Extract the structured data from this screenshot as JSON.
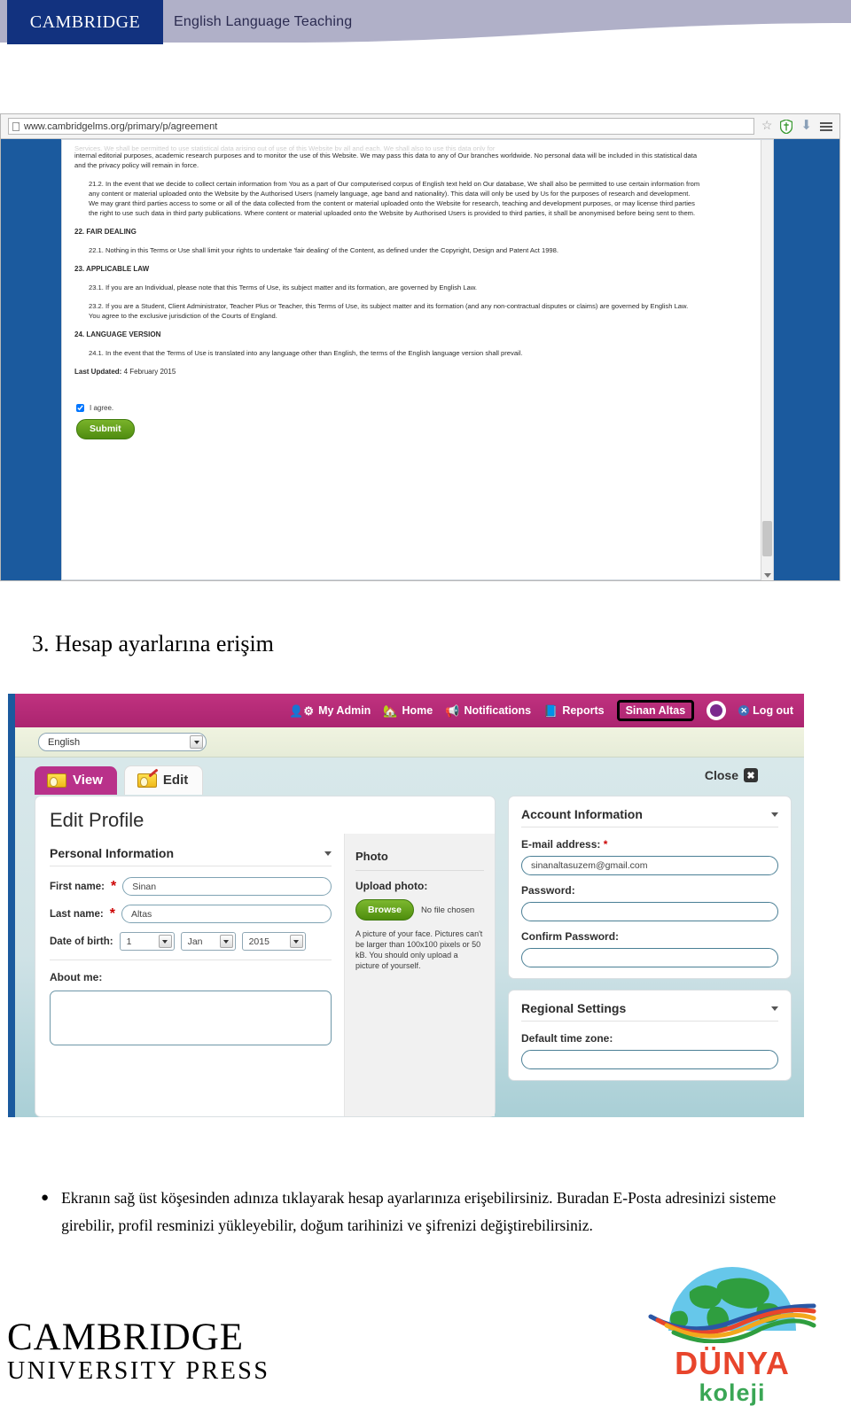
{
  "banner": {
    "brand": "CAMBRIDGE",
    "tagline": "English Language Teaching"
  },
  "browser": {
    "url": "www.cambridgelms.org/primary/p/agreement",
    "icons": {
      "page": "page-icon",
      "bookmark": "star-icon",
      "shield": "shield-icon",
      "download": "download-arrow-icon",
      "menu": "hamburger-menu-icon"
    }
  },
  "agreement": {
    "clipped_line": "Services. We shall be permitted to use statistical data arising out of use of this Website by all and each. We shall also to use this data only for",
    "para_1": "internal editorial purposes, academic research purposes and to monitor the use of this Website. We may pass this data to any of Our branches worldwide. No personal data will be included in this statistical data and the privacy policy will remain in force.",
    "para_21_2": "21.2. In the event that we decide to collect certain information from You as a part of Our computerised corpus of English text held on Our database, We shall also be permitted to use certain information from any content or material uploaded onto the Website by the Authorised Users (namely language, age band and nationality). This data will only be used by Us for the purposes of research and development. We may grant third parties access to some or all of the data collected from the content or material uploaded onto the Website for research, teaching and development purposes, or may license third parties the right to use such data in third party publications. Where content or material uploaded onto the Website by Authorised Users is provided to third parties, it shall be anonymised before being sent to them.",
    "head_22": "22. FAIR DEALING",
    "para_22_1": "22.1. Nothing in this Terms or Use shall limit your rights to undertake 'fair dealing' of the Content, as defined under the Copyright, Design and Patent Act 1998.",
    "head_23": "23. APPLICABLE LAW",
    "para_23_1": "23.1. If you are an Individual, please note that this Terms of Use, its subject matter and its formation, are governed by English Law.",
    "para_23_2": "23.2. If you are a Student, Client Administrator, Teacher Plus or Teacher, this Terms of Use, its subject matter and its formation (and any non-contractual disputes or claims) are governed by English Law. You agree to the exclusive jurisdiction of the Courts of England.",
    "head_24": "24. LANGUAGE VERSION",
    "para_24_1": "24.1. In the event that the Terms of Use is translated into any language other than English, the terms of the English language version shall prevail.",
    "last_updated_label": "Last Updated:",
    "last_updated_value": "4 February 2015",
    "agree_label": "I agree.",
    "submit_label": "Submit"
  },
  "section_heading": "3. Hesap ayarlarına erişim",
  "app": {
    "nav": [
      {
        "label": "My Admin",
        "icon": "admin-user-icon"
      },
      {
        "label": "Home",
        "icon": "home-icon"
      },
      {
        "label": "Notifications",
        "icon": "megaphone-icon"
      },
      {
        "label": "Reports",
        "icon": "reports-book-icon"
      }
    ],
    "username": "Sinan Altas",
    "logout_label": "Log out",
    "language_selected": "English",
    "tabs": [
      {
        "label": "View",
        "active": true,
        "icon": "view-card-icon"
      },
      {
        "label": "Edit",
        "active": false,
        "icon": "edit-pencil-icon"
      }
    ],
    "close_label": "Close",
    "edit_profile_title": "Edit Profile",
    "personal": {
      "section_title": "Personal Information",
      "first_name_label": "First name:",
      "first_name_value": "Sinan",
      "last_name_label": "Last name:",
      "last_name_value": "Altas",
      "dob_label": "Date of birth:",
      "dob_day": "1",
      "dob_month": "Jan",
      "dob_year": "2015",
      "about_label": "About me:",
      "about_value": ""
    },
    "photo": {
      "section_title": "Photo",
      "upload_label": "Upload photo:",
      "browse_label": "Browse",
      "no_file_text": "No file chosen",
      "help_text": "A picture of your face. Pictures can't be larger than 100x100 pixels or 50 kB. You should only upload a picture of yourself."
    },
    "account": {
      "section_title": "Account Information",
      "email_label": "E-mail address:",
      "email_value": "sinanaltasuzem@gmail.com",
      "password_label": "Password:",
      "password_value": "",
      "confirm_label": "Confirm Password:",
      "confirm_value": ""
    },
    "regional": {
      "section_title": "Regional Settings",
      "timezone_label": "Default time zone:"
    }
  },
  "bullet_text": "Ekranın sağ üst köşesinden adınıza tıklayarak hesap ayarlarınıza erişebilirsiniz. Buradan E-Posta adresinizi sisteme girebilir, profil resminizi yükleyebilir, doğum tarihinizi ve şifrenizi değiştirebilirsiniz.",
  "footer": {
    "cup_line1": "CAMBRIDGE",
    "cup_line2": "UNIVERSITY PRESS",
    "dunya_line1": "DÜNYA",
    "dunya_line2": "koleji"
  },
  "colors": {
    "cambridge_blue": "#12327f",
    "banner_lilac": "#b0b0c8",
    "app_magenta": "#b9318a",
    "green_button": "#4e8d0d",
    "browser_blue": "#1b5a9e",
    "dunya_red": "#e8452c",
    "dunya_green": "#3aa655"
  }
}
